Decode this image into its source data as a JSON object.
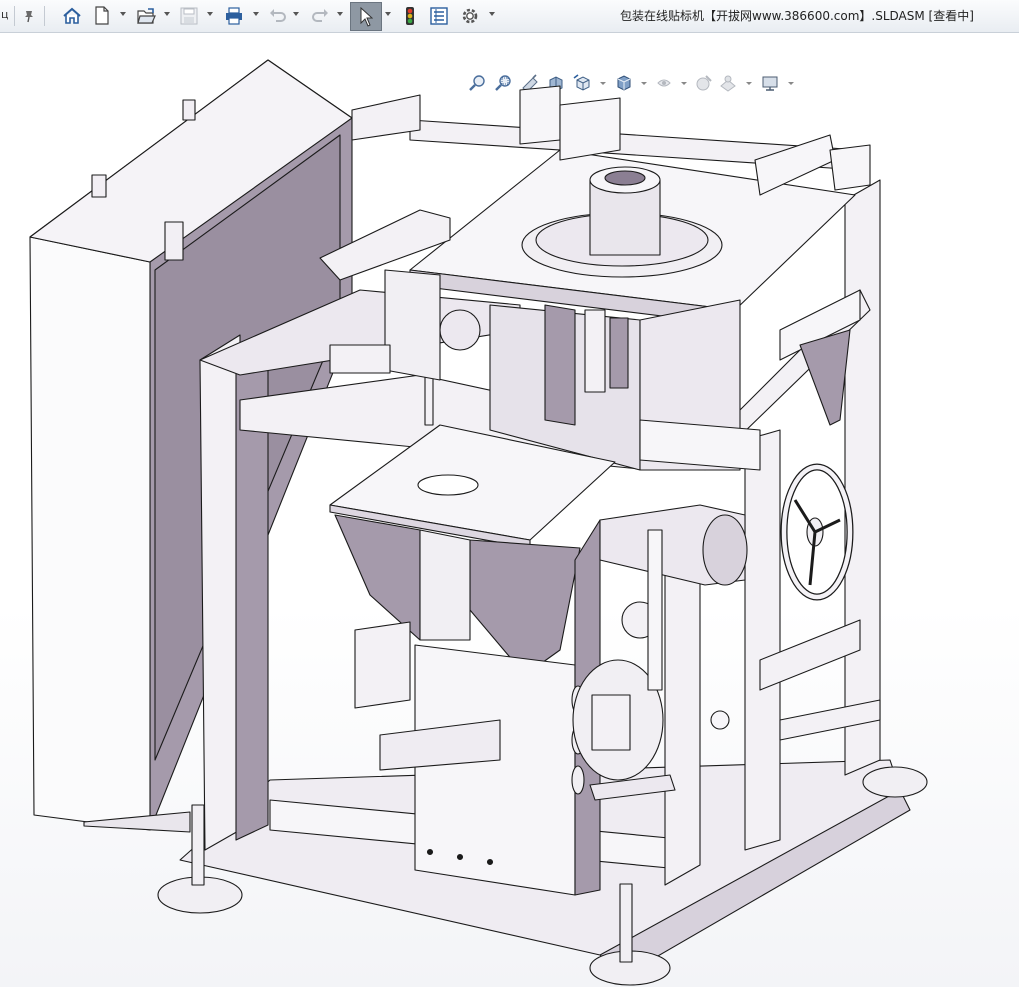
{
  "window": {
    "title": "包装在线贴标机【开拔网www.386600.com】.SLDASM [查看中]",
    "clipped_left_glyph": "ц"
  },
  "toolbar": {
    "items": [
      {
        "name": "pin",
        "icon": "pin-icon"
      },
      {
        "name": "home",
        "icon": "home-icon"
      },
      {
        "name": "new",
        "icon": "new-document-icon",
        "dropdown": true
      },
      {
        "name": "open",
        "icon": "open-folder-icon",
        "dropdown": true
      },
      {
        "name": "save",
        "icon": "save-icon",
        "dropdown": true,
        "disabled": true
      },
      {
        "name": "print",
        "icon": "print-icon",
        "dropdown": true
      },
      {
        "name": "undo",
        "icon": "undo-icon",
        "dropdown": true,
        "disabled": true
      },
      {
        "name": "redo",
        "icon": "redo-icon",
        "dropdown": true,
        "disabled": true
      },
      {
        "name": "select",
        "icon": "select-arrow-icon",
        "dropdown": true,
        "active": true
      },
      {
        "name": "traffic-light",
        "icon": "traffic-light-icon"
      },
      {
        "name": "file-properties",
        "icon": "file-properties-icon"
      },
      {
        "name": "options",
        "icon": "gear-icon",
        "dropdown": true
      }
    ]
  },
  "headsup": {
    "items": [
      {
        "name": "zoom-to-fit",
        "icon": "zoom-to-fit-icon"
      },
      {
        "name": "zoom-area",
        "icon": "zoom-area-icon"
      },
      {
        "name": "previous-view",
        "icon": "previous-view-icon"
      },
      {
        "name": "section-view",
        "icon": "section-view-icon"
      },
      {
        "name": "view-orientation",
        "icon": "view-orientation-icon",
        "dropdown": true
      },
      {
        "name": "display-style",
        "icon": "display-style-icon",
        "dropdown": true
      },
      {
        "name": "hide-show",
        "icon": "hide-show-icon",
        "dropdown": true
      },
      {
        "name": "edit-appearance",
        "icon": "edit-appearance-icon",
        "dropdown": true
      },
      {
        "name": "apply-scene",
        "icon": "apply-scene-icon",
        "dropdown": true
      },
      {
        "name": "view-settings",
        "icon": "view-settings-icon",
        "dropdown": true
      }
    ]
  },
  "colors": {
    "model_face": "#f1eef3",
    "model_shade": "#a59aab",
    "model_dark": "#8b7f93",
    "edge": "#1b1b1b",
    "toolbar_icon_blue": "#2c5f9e"
  }
}
